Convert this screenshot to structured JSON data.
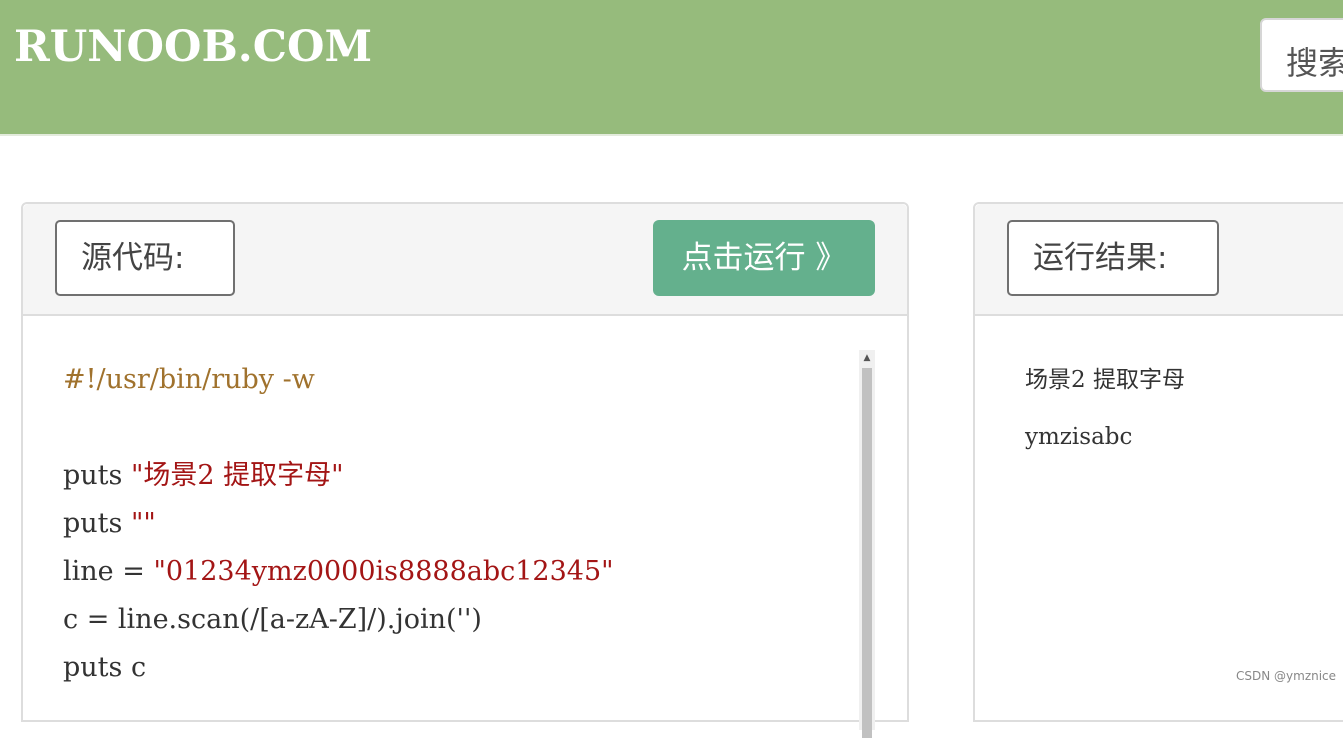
{
  "header": {
    "logo": "RUNOOB.COM",
    "search_label": "搜索"
  },
  "source_panel": {
    "label": "源代码:",
    "run_button": "点击运行 》",
    "code_lines": [
      {
        "parts": [
          {
            "text": "#!/usr/bin/ruby -w",
            "kind": "meta"
          }
        ]
      },
      {
        "parts": []
      },
      {
        "parts": [
          {
            "text": "puts ",
            "kind": "plain"
          },
          {
            "text": "\"场景2 提取字母\"",
            "kind": "string"
          }
        ]
      },
      {
        "parts": [
          {
            "text": "puts ",
            "kind": "plain"
          },
          {
            "text": "\"\"",
            "kind": "string"
          }
        ]
      },
      {
        "parts": [
          {
            "text": "line = ",
            "kind": "plain"
          },
          {
            "text": "\"01234ymz0000is8888abc12345\"",
            "kind": "string"
          }
        ]
      },
      {
        "parts": [
          {
            "text": "c = line.scan(/[a-zA-Z]/).join('')",
            "kind": "plain"
          }
        ]
      },
      {
        "parts": [
          {
            "text": "puts c",
            "kind": "plain"
          }
        ]
      }
    ]
  },
  "result_panel": {
    "label": "运行结果:",
    "lines": [
      "场景2 提取字母",
      "ymzisabc"
    ]
  },
  "watermark": "CSDN @ymznice",
  "colors": {
    "header_bg": "#96bb7c",
    "run_button_bg": "#64b08d",
    "meta_color": "#a0722d",
    "string_color": "#a31515"
  }
}
